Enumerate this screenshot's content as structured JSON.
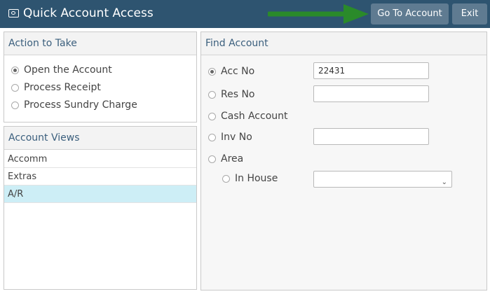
{
  "header": {
    "title": "Quick Account Access",
    "icon": "camera-money-icon",
    "buttons": {
      "go_to_account": "Go To Account",
      "exit": "Exit"
    },
    "colors": {
      "bar": "#2e5470",
      "button": "#5f7b91",
      "arrow": "#2a8a2a"
    }
  },
  "action_panel": {
    "title": "Action to Take",
    "options": [
      {
        "label": "Open the Account",
        "checked": true
      },
      {
        "label": "Process Receipt",
        "checked": false
      },
      {
        "label": "Process Sundry Charge",
        "checked": false
      }
    ]
  },
  "views_panel": {
    "title": "Account Views",
    "items": [
      {
        "label": "Accomm",
        "selected": false
      },
      {
        "label": "Extras",
        "selected": false
      },
      {
        "label": "A/R",
        "selected": true
      }
    ]
  },
  "find_panel": {
    "title": "Find Account",
    "options": [
      {
        "label": "Acc No",
        "checked": true,
        "value": "22431"
      },
      {
        "label": "Res No",
        "checked": false,
        "value": ""
      },
      {
        "label": "Cash Account",
        "checked": false
      },
      {
        "label": "Inv No",
        "checked": false,
        "value": ""
      },
      {
        "label": "Area",
        "checked": false
      },
      {
        "label": "In House",
        "checked": false,
        "selected_value": ""
      }
    ]
  }
}
